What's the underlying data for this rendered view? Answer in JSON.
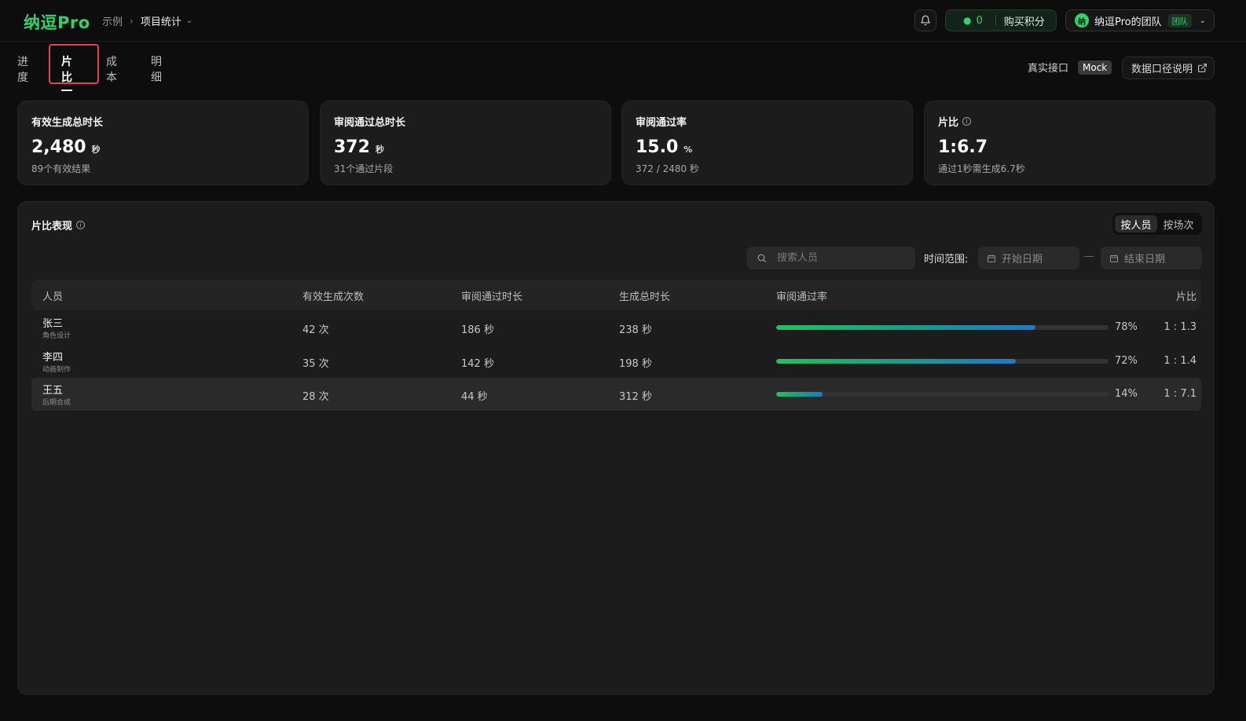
{
  "header": {
    "logo": "纳逗Pro",
    "breadcrumb": [
      "示例",
      "项目统计"
    ],
    "credits": "0",
    "buy_label": "购买积分",
    "team_avatar": "纳",
    "team_name": "纳逗Pro的团队",
    "team_badge": "团队"
  },
  "tabs": [
    {
      "label": "进度"
    },
    {
      "label": "片比"
    },
    {
      "label": "成本"
    },
    {
      "label": "明细"
    }
  ],
  "active_tab": "片比",
  "source": {
    "real_label": "真实接口",
    "mock_label": "Mock",
    "doc_label": "数据口径说明"
  },
  "cards": [
    {
      "title": "有效生成总时长",
      "value": "2,480",
      "unit": "秒",
      "sub": "89个有效结果"
    },
    {
      "title": "审阅通过总时长",
      "value": "372",
      "unit": "秒",
      "sub": "31个通过片段"
    },
    {
      "title": "审阅通过率",
      "value": "15.0",
      "unit": "%",
      "sub": "372 / 2480 秒"
    },
    {
      "title": "片比",
      "value": "1:6.7",
      "unit": "",
      "sub": "通过1秒需生成6.7秒"
    }
  ],
  "panel": {
    "title": "片比表现",
    "toggle": [
      "按人员",
      "按场次"
    ],
    "search_placeholder": "搜索人员",
    "time_range_label": "时间范围:",
    "start_placeholder": "开始日期",
    "end_placeholder": "结束日期",
    "dash": "—",
    "columns": [
      "人员",
      "有效生成次数",
      "审阅通过时长",
      "生成总时长",
      "审阅通过率",
      "片比"
    ],
    "rows": [
      {
        "name": "张三",
        "role": "角色设计",
        "count": "42 次",
        "passed": "186 秒",
        "total": "238 秒",
        "rate": 78,
        "rate_label": "78%",
        "ratio": "1 : 1.3"
      },
      {
        "name": "李四",
        "role": "动画制作",
        "count": "35 次",
        "passed": "142 秒",
        "total": "198 秒",
        "rate": 72,
        "rate_label": "72%",
        "ratio": "1 : 1.4"
      },
      {
        "name": "王五",
        "role": "后期合成",
        "count": "28 次",
        "passed": "44 秒",
        "total": "312 秒",
        "rate": 14,
        "rate_label": "14%",
        "ratio": "1 : 7.1"
      }
    ]
  },
  "colors": {
    "brand": "#2fd36b",
    "focus_outline": "#e0464b"
  }
}
